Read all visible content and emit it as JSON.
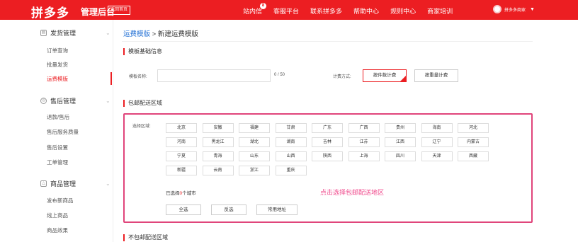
{
  "header": {
    "logo": "拼多多",
    "logo_sub": "管理后台",
    "home": "返回首页",
    "nav": [
      "站内信",
      "客服平台",
      "联系拼多多",
      "帮助中心",
      "规则中心",
      "商家培训"
    ],
    "badge": "8",
    "user": "拼多多商家",
    "brand_color": "#ec1e22"
  },
  "sidebar": {
    "sections": [
      {
        "title": "发货管理",
        "icon": "truck-icon",
        "items": [
          "订单查询",
          "批量发货",
          "运费模版"
        ]
      },
      {
        "title": "售后管理",
        "icon": "service-icon",
        "items": [
          "退款/售后",
          "售后服务质量",
          "售后设置",
          "工单管理"
        ]
      },
      {
        "title": "商品管理",
        "icon": "bag-icon",
        "items": [
          "发布新商品",
          "线上商品",
          "商品效果"
        ]
      }
    ],
    "active": "运费模版"
  },
  "breadcrumb": {
    "link": "运费模版",
    "sep": " > ",
    "current": "新建运费模版"
  },
  "basic": {
    "title": "模板基础信息",
    "name_label": "模板名称:",
    "name_value": "",
    "counter": "0 / 50",
    "fee_label": "计费方式:",
    "fee_options": [
      "按件数计费",
      "按重量计费"
    ],
    "fee_selected": "按件数计费"
  },
  "free_region": {
    "title": "包邮配送区域",
    "select_label": "选择区域:",
    "provinces": [
      [
        "北京",
        "安徽",
        "福建",
        "甘肃",
        "广东",
        "广西",
        "贵州",
        "海南",
        "河北"
      ],
      [
        "河南",
        "黑龙江",
        "湖北",
        "湖南",
        "吉林",
        "江苏",
        "江西",
        "辽宁",
        "内蒙古"
      ],
      [
        "宁夏",
        "青海",
        "山东",
        "山西",
        "陕西",
        "上海",
        "四川",
        "天津",
        "西藏"
      ],
      [
        "新疆",
        "云南",
        "浙江",
        "重庆"
      ]
    ],
    "count_prefix": "已选择",
    "count": "0",
    "count_suffix": "个城市",
    "hint": "点击选择包邮配送地区",
    "actions": [
      "全选",
      "反选",
      "常用地址"
    ]
  },
  "non_free_region": {
    "title": "不包邮配送区域"
  }
}
